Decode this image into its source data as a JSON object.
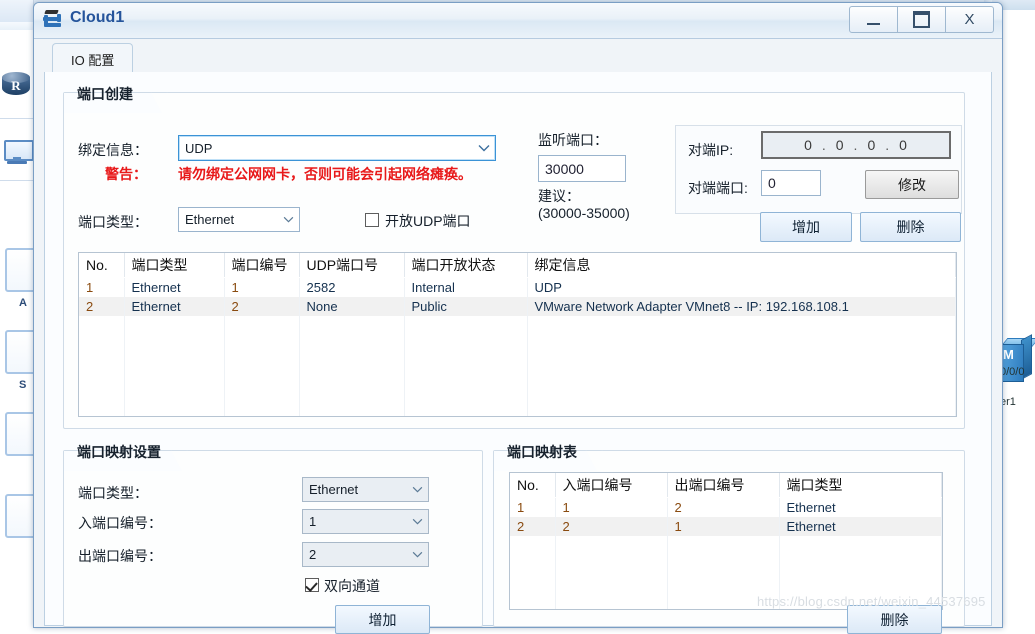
{
  "window": {
    "title": "Cloud1",
    "icon": "cloud-icon",
    "minimize": "—",
    "maximize": "▭",
    "close": "X"
  },
  "tabs": [
    {
      "label": "IO 配置",
      "active": true
    }
  ],
  "port_create": {
    "group_title": "端口创建",
    "binding_label": "绑定信息：",
    "binding_value": "UDP",
    "warning_label": "警告：",
    "warning_text": "请勿绑定公网网卡，否则可能会引起网络瘫痪。",
    "port_type_label": "端口类型：",
    "port_type_value": "Ethernet",
    "open_udp_label": "开放UDP端口",
    "open_udp_checked": false,
    "listen_port_label": "监听端口：",
    "listen_port_value": "30000",
    "suggest_label": "建议：",
    "suggest_range": "(30000-35000)",
    "peer_ip_label": "对端IP:",
    "peer_ip": [
      "0",
      "0",
      "0",
      "0"
    ],
    "peer_port_label": "对端端口:",
    "peer_port_value": "0",
    "modify_button": "修改",
    "add_button": "增加",
    "delete_button": "删除"
  },
  "port_table": {
    "columns": [
      "No.",
      "端口类型",
      "端口编号",
      "UDP端口号",
      "端口开放状态",
      "绑定信息"
    ],
    "rows": [
      [
        "1",
        "Ethernet",
        "1",
        "2582",
        "Internal",
        "UDP"
      ],
      [
        "2",
        "Ethernet",
        "2",
        "None",
        "Public",
        "VMware Network Adapter VMnet8 -- IP: 192.168.108.1"
      ]
    ],
    "empty_row_count": 5,
    "selected_row_index": 1
  },
  "mapping_settings": {
    "group_title": "端口映射设置",
    "port_type_label": "端口类型：",
    "port_type_value": "Ethernet",
    "in_port_label": "入端口编号：",
    "in_port_value": "1",
    "out_port_label": "出端口编号：",
    "out_port_value": "2",
    "bidirectional_label": "双向通道",
    "bidirectional_checked": true,
    "add_button": "增加"
  },
  "mapping_table": {
    "group_title": "端口映射表",
    "columns": [
      "No.",
      "入端口编号",
      "出端口编号",
      "端口类型"
    ],
    "rows": [
      [
        "1",
        "1",
        "2",
        "Ethernet"
      ],
      [
        "2",
        "2",
        "1",
        "Ethernet"
      ]
    ],
    "empty_row_count": 3,
    "selected_row_index": 1,
    "delete_button": "删除"
  },
  "background": {
    "router_label": "R",
    "right_device_label": "M",
    "right_device_port": "0/0/0",
    "right_device_name": "er1",
    "left_label_a": "A",
    "left_label_s": "S"
  },
  "watermark": "https://blog.csdn.net/weixin_44537695",
  "colors": {
    "accent": "#25549b",
    "warning": "#e8191a",
    "button_blue": "#8fb4d6",
    "selected_row": "#f1f1f1"
  }
}
